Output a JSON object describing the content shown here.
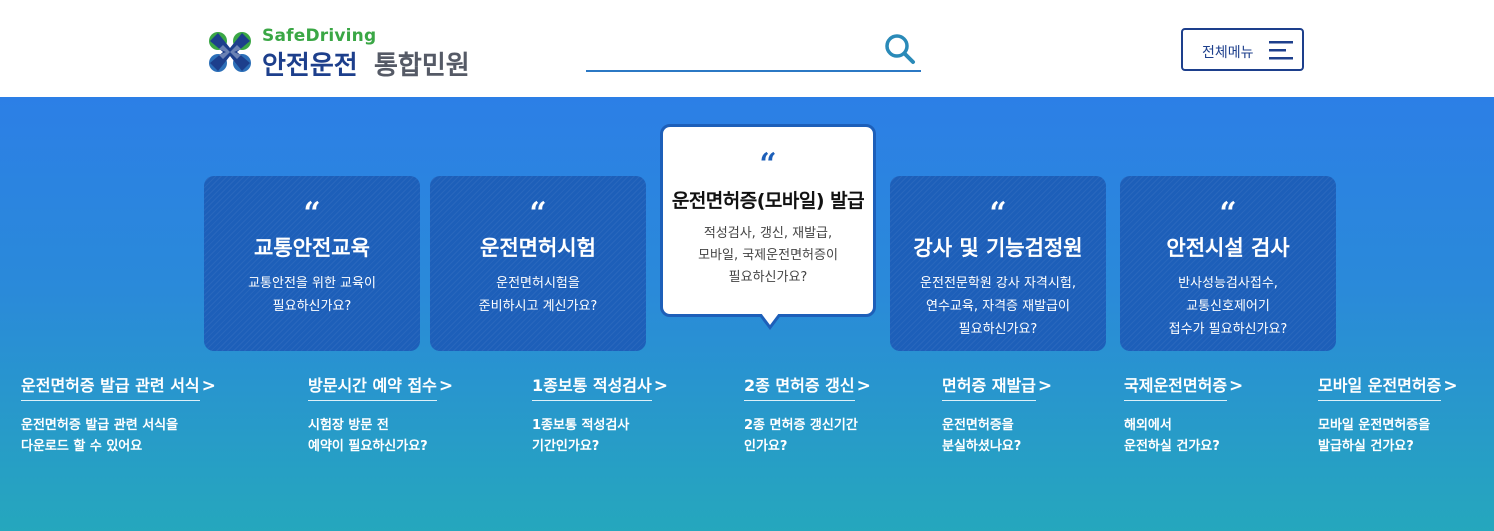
{
  "header": {
    "logo_sub": "SafeDriving",
    "logo_main": "안전운전",
    "logo_main2": "통합민원",
    "search_placeholder": "",
    "menu_label": "전체메뉴"
  },
  "colors": {
    "brand_navy": "#1d3f8c",
    "brand_green": "#3aa745",
    "card_blue": "#1d5fb9",
    "search_teal": "#2a8ab8"
  },
  "cards": [
    {
      "quote": "“",
      "title": "교통안전교육",
      "desc1": "교통안전을 위한 교육이",
      "desc2": "필요하신가요?",
      "desc3": ""
    },
    {
      "quote": "“",
      "title": "운전면허시험",
      "desc1": "운전면허시험을",
      "desc2": "준비하시고 계신가요?",
      "desc3": ""
    },
    {
      "quote": "“",
      "title": "운전면허증(모바일) 발급",
      "desc1": "적성검사, 갱신, 재발급,",
      "desc2": "모바일, 국제운전면허증이",
      "desc3": "필요하신가요?"
    },
    {
      "quote": "“",
      "title": "강사 및 기능검정원",
      "desc1": "운전전문학원 강사 자격시험,",
      "desc2": "연수교육, 자격증 재발급이",
      "desc3": "필요하신가요?"
    },
    {
      "quote": "“",
      "title": "안전시설 검사",
      "desc1": "반사성능검사접수,",
      "desc2": "교통신호제어기",
      "desc3": "접수가 필요하신가요?"
    }
  ],
  "quick_links": [
    {
      "title": "운전면허증 발급 관련 서식",
      "desc1": "운전면허증 발급 관련 서식을",
      "desc2": "다운로드 할 수 있어요"
    },
    {
      "title": "방문시간 예약 접수",
      "desc1": "시험장 방문 전",
      "desc2": "예약이 필요하신가요?"
    },
    {
      "title": "1종보통 적성검사",
      "desc1": "1종보통 적성검사",
      "desc2": "기간인가요?"
    },
    {
      "title": "2종 면허증 갱신",
      "desc1": "2종 면허증 갱신기간",
      "desc2": "인가요?"
    },
    {
      "title": "면허증 재발급",
      "desc1": "운전면허증을",
      "desc2": "분실하셨나요?"
    },
    {
      "title": "국제운전면허증",
      "desc1": "해외에서",
      "desc2": "운전하실 건가요?"
    },
    {
      "title": "모바일 운전면허증",
      "desc1": "모바일 운전면허증을",
      "desc2": "발급하실 건가요?"
    }
  ],
  "arrow_glyph": ">"
}
